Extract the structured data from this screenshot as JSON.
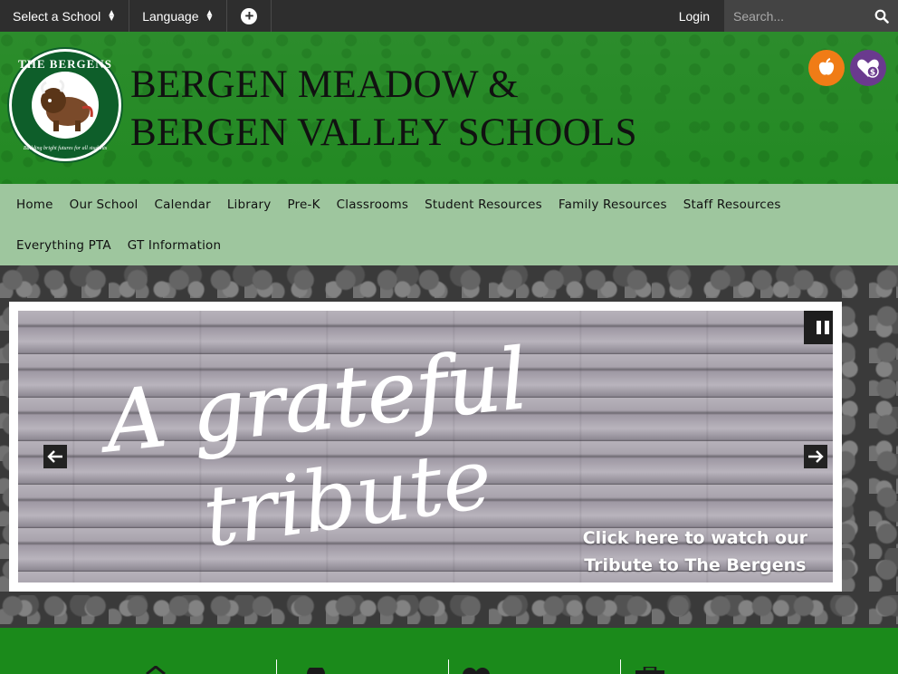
{
  "topbar": {
    "select_school": "Select a School",
    "language": "Language",
    "login": "Login",
    "search_placeholder": "Search..."
  },
  "header": {
    "logo_title": "THE BERGENS",
    "logo_tagline": "Building bright futures for all students",
    "school_name_line1": "BERGEN MEADOW &",
    "school_name_line2": "BERGEN VALLEY SCHOOLS"
  },
  "nav": {
    "items": [
      "Home",
      "Our School",
      "Calendar",
      "Library",
      "Pre-K",
      "Classrooms",
      "Student Resources",
      "Family Resources",
      "Staff Resources",
      "Everything PTA",
      "GT Information"
    ]
  },
  "slideshow": {
    "script_line1": "A grateful",
    "script_line2": "tribute",
    "cta_line1": "Click here to watch our",
    "cta_line2": "Tribute to The Bergens"
  },
  "colors": {
    "header_green": "#2a8c2a",
    "nav_light_green": "#9ec69e",
    "apple_orange": "#f07c16",
    "donate_purple": "#6a3a8e",
    "bottom_green": "#1b8a1b"
  },
  "icons": [
    "plus-circle-icon",
    "search-icon",
    "apple-icon",
    "heart-dollar-icon",
    "pause-icon",
    "arrow-left-icon",
    "arrow-right-icon"
  ]
}
